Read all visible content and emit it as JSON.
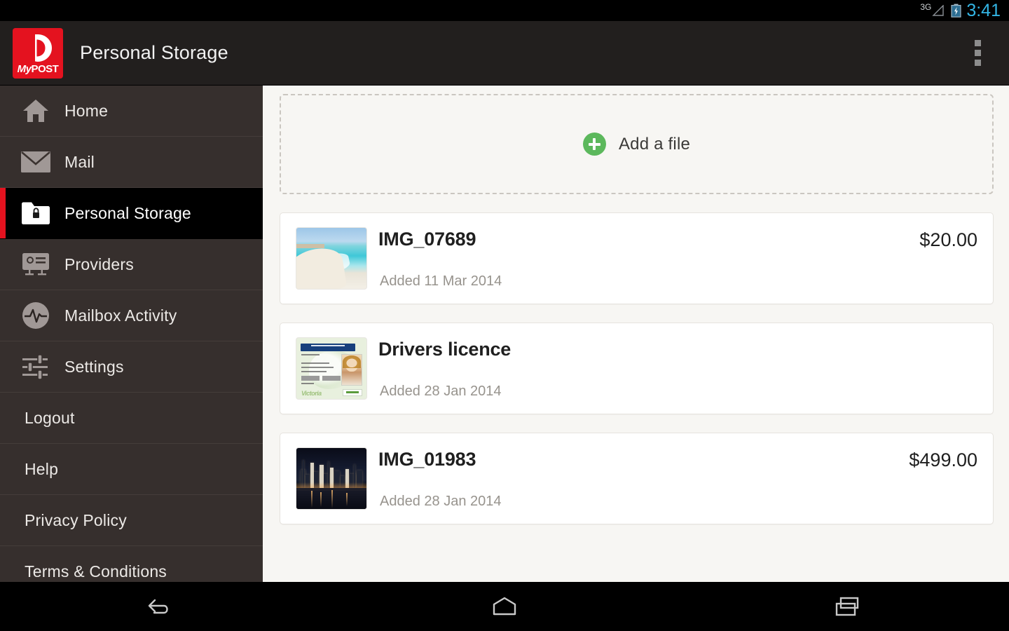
{
  "status_bar": {
    "network": "3G",
    "clock": "3:41",
    "clock_color": "#33b5e5",
    "battery_icon": "battery-charging-icon",
    "signal_icon": "signal-bars-icon"
  },
  "action_bar": {
    "logo_text_my": "My",
    "logo_text_post": "POST",
    "logo_icon": "australia-post-p-logo",
    "title": "Personal Storage",
    "overflow_icon": "overflow-menu-icon",
    "background": "#221f1e",
    "brand_red": "#e4121f"
  },
  "sidebar": {
    "background": "#362f2d",
    "selected_background": "#000000",
    "selected_indicator_color": "#e4121f",
    "items": [
      {
        "label": "Home",
        "icon": "home-icon",
        "selected": false,
        "has_icon": true
      },
      {
        "label": "Mail",
        "icon": "envelope-icon",
        "selected": false,
        "has_icon": true
      },
      {
        "label": "Personal Storage",
        "icon": "locked-folder-icon",
        "selected": true,
        "has_icon": true
      },
      {
        "label": "Providers",
        "icon": "id-card-icon",
        "selected": false,
        "has_icon": true
      },
      {
        "label": "Mailbox Activity",
        "icon": "activity-pulse-icon",
        "selected": false,
        "has_icon": true
      },
      {
        "label": "Settings",
        "icon": "sliders-icon",
        "selected": false,
        "has_icon": true
      },
      {
        "label": "Logout",
        "icon": "",
        "selected": false,
        "has_icon": false
      },
      {
        "label": "Help",
        "icon": "",
        "selected": false,
        "has_icon": false
      },
      {
        "label": "Privacy Policy",
        "icon": "",
        "selected": false,
        "has_icon": false
      },
      {
        "label": "Terms & Conditions",
        "icon": "",
        "selected": false,
        "has_icon": false
      }
    ]
  },
  "main": {
    "background": "#f7f6f3",
    "add_file": {
      "label": "Add a file",
      "icon": "plus-circle-icon",
      "icon_color": "#5cb85c"
    },
    "files": [
      {
        "title": "IMG_07689",
        "added": "Added 11 Mar 2014",
        "price": "$20.00",
        "thumbnail": "beach-photo-thumbnail"
      },
      {
        "title": "Drivers licence",
        "added": "Added 28 Jan 2014",
        "price": "",
        "thumbnail": "drivers-licence-thumbnail"
      },
      {
        "title": "IMG_01983",
        "added": "Added 28 Jan 2014",
        "price": "$499.00",
        "thumbnail": "city-skyline-photo-thumbnail"
      }
    ]
  },
  "system_nav": {
    "back_icon": "back-arrow-icon",
    "home_icon": "home-pentagon-icon",
    "recents_icon": "recent-apps-icon"
  }
}
